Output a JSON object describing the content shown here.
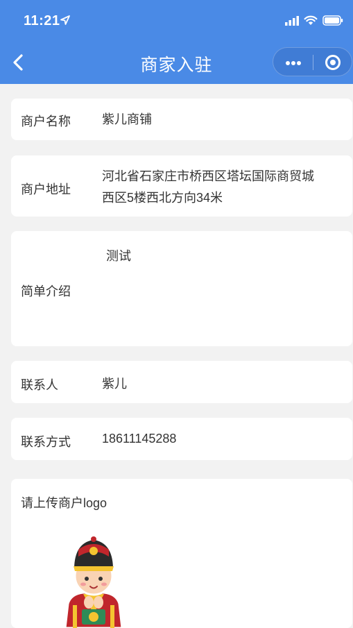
{
  "status_bar": {
    "time": "11:21"
  },
  "nav": {
    "title": "商家入驻"
  },
  "form": {
    "merchant_name": {
      "label": "商户名称",
      "value": "紫儿商铺"
    },
    "merchant_address": {
      "label": "商户地址",
      "value_line1": "河北省石家庄市桥西区塔坛国际商贸城",
      "value_line2": "西区5楼西北方向34米"
    },
    "intro": {
      "label": "简单介绍",
      "value": "测试"
    },
    "contact_person": {
      "label": "联系人",
      "value": "紫儿"
    },
    "contact_phone": {
      "label": "联系方式",
      "value": "18611145288"
    },
    "logo_upload": {
      "label": "请上传商户logo"
    }
  },
  "colors": {
    "nav_bg": "#4a8ae6",
    "page_bg": "#f2f2f2",
    "card_bg": "#ffffff",
    "text": "#333333"
  },
  "icons": [
    "location-arrow-icon",
    "signal-icon",
    "wifi-icon",
    "battery-icon",
    "back-chevron-icon",
    "more-dots-icon",
    "close-target-icon"
  ]
}
